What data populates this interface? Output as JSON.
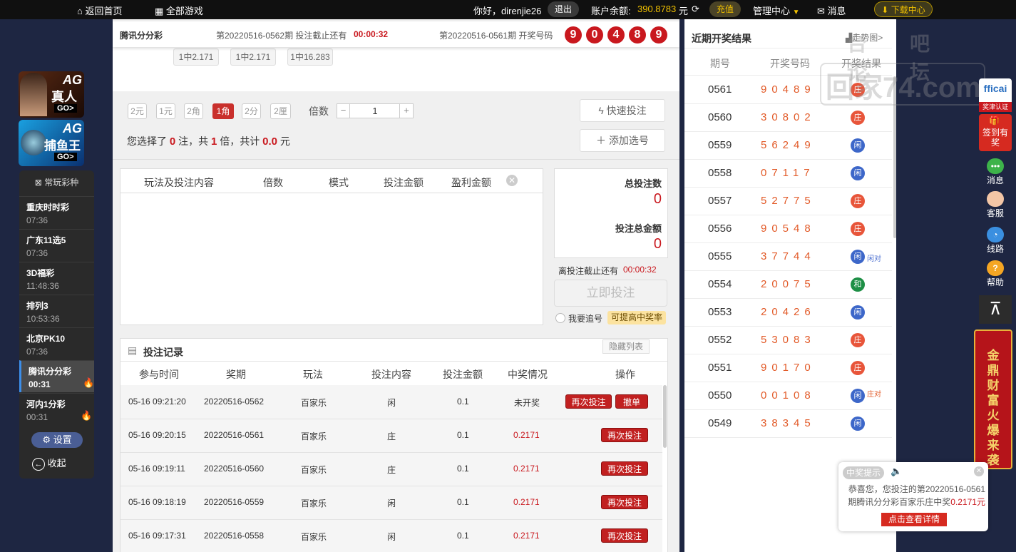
{
  "topbar": {
    "home": "返回首页",
    "all_games": "全部游戏",
    "greeting": "你好，direnjie26",
    "logout": "退出",
    "balance_label": "账户余额:",
    "balance_value": "390.8783",
    "balance_unit": "元",
    "recharge": "充值",
    "manage": "管理中心",
    "message": "消息",
    "download": "下载中心"
  },
  "left": {
    "banner1": {
      "top": "AG",
      "bottom": "真人",
      "go": "GO>"
    },
    "banner2": {
      "top": "AG",
      "bottom": "捕鱼王",
      "go": "GO>"
    },
    "menu_title": "常玩彩种",
    "items": [
      {
        "name": "重庆时时彩",
        "time": "07:36"
      },
      {
        "name": "广东11选5",
        "time": "07:36"
      },
      {
        "name": "3D福彩",
        "time": "11:48:36"
      },
      {
        "name": "排列3",
        "time": "10:53:36"
      },
      {
        "name": "北京PK10",
        "time": "07:36"
      },
      {
        "name": "腾讯分分彩",
        "time": "00:31"
      },
      {
        "name": "河内1分彩",
        "time": "00:31"
      }
    ],
    "settings": "设置",
    "collapse": "收起"
  },
  "header": {
    "game": "腾讯分分彩",
    "current_period": "第20220516-0562期 投注截止还有",
    "countdown": "00:00:32",
    "last_period": "第20220516-0561期 开奖号码",
    "numbers": [
      "9",
      "0",
      "4",
      "8",
      "9"
    ]
  },
  "odds": [
    "1中2.171",
    "1中2.171",
    "1中16.283"
  ],
  "units": [
    "2元",
    "1元",
    "2角",
    "1角",
    "2分",
    "2厘"
  ],
  "multiplier_label": "倍数",
  "multiplier_value": "1",
  "quick_bet": "快速投注",
  "add_selection": "添加选号",
  "selection_summary": {
    "prefix": "您选择了",
    "count": "0",
    "mid1": "注，共",
    "times": "1",
    "mid2": "倍，共计",
    "amount": "0.0",
    "unit": "元"
  },
  "bet_table_headers": [
    "玩法及投注内容",
    "倍数",
    "模式",
    "投注金额",
    "盈利金额"
  ],
  "totals": {
    "count_label": "总投注数",
    "count": "0",
    "amount_label": "投注总金额",
    "amount": "0"
  },
  "deadline_label": "离投注截止还有",
  "deadline": "00:00:32",
  "bet_now": "立即投注",
  "chase_label": "我要追号",
  "boost": "可提高中奖率",
  "records": {
    "title": "投注记录",
    "hide": "隐藏列表",
    "headers": [
      "参与时间",
      "奖期",
      "玩法",
      "投注内容",
      "投注金额",
      "中奖情况",
      "操作"
    ],
    "rows": [
      {
        "time": "05-16 09:21:20",
        "period": "20220516-0562",
        "play": "百家乐",
        "content": "闲",
        "amount": "0.1",
        "result": "未开奖",
        "action": "再次投注",
        "cancel": "撤单"
      },
      {
        "time": "05-16 09:20:15",
        "period": "20220516-0561",
        "play": "百家乐",
        "content": "庄",
        "amount": "0.1",
        "result": "0.2171",
        "action": "再次投注"
      },
      {
        "time": "05-16 09:19:11",
        "period": "20220516-0560",
        "play": "百家乐",
        "content": "庄",
        "amount": "0.1",
        "result": "0.2171",
        "action": "再次投注"
      },
      {
        "time": "05-16 09:18:19",
        "period": "20220516-0559",
        "play": "百家乐",
        "content": "闲",
        "amount": "0.1",
        "result": "0.2171",
        "action": "再次投注"
      },
      {
        "time": "05-16 09:17:31",
        "period": "20220516-0558",
        "play": "百家乐",
        "content": "闲",
        "amount": "0.1",
        "result": "0.2171",
        "action": "再次投注"
      }
    ]
  },
  "results": {
    "title": "近期开奖结果",
    "trend": "走势图>",
    "headers": [
      "期号",
      "开奖号码",
      "开奖结果"
    ],
    "rows": [
      {
        "p": "0561",
        "c": "90489",
        "r": "庄"
      },
      {
        "p": "0560",
        "c": "30802",
        "r": "庄"
      },
      {
        "p": "0559",
        "c": "56249",
        "r": "闲"
      },
      {
        "p": "0558",
        "c": "07117",
        "r": "闲"
      },
      {
        "p": "0557",
        "c": "52775",
        "r": "庄"
      },
      {
        "p": "0556",
        "c": "90548",
        "r": "庄"
      },
      {
        "p": "0555",
        "c": "37744",
        "r": "闲",
        "x": "闲对"
      },
      {
        "p": "0554",
        "c": "20075",
        "r": "和"
      },
      {
        "p": "0553",
        "c": "20426",
        "r": "闲"
      },
      {
        "p": "0552",
        "c": "53083",
        "r": "庄"
      },
      {
        "p": "0551",
        "c": "90170",
        "r": "庄"
      },
      {
        "p": "0550",
        "c": "00108",
        "r": "闲",
        "x": "庄对"
      },
      {
        "p": "0549",
        "c": "38345",
        "r": "闲"
      }
    ]
  },
  "watermark": {
    "line1": "台吧 论坛",
    "line2": "回家74.com"
  },
  "side": {
    "brand": "fficai",
    "brand_sub": "奖津认证",
    "sign": "签到有奖",
    "message": "消息",
    "service": "客服",
    "route": "线路",
    "help": "帮助",
    "promo": "金鼎财富火爆来袭"
  },
  "popup": {
    "tag": "中奖提示",
    "text1": "恭喜您，您投注的第20220516-0561",
    "text2a": "期腾讯分分彩百家乐庄中奖",
    "text2b": "0.2171元",
    "button": "点击查看详情"
  }
}
